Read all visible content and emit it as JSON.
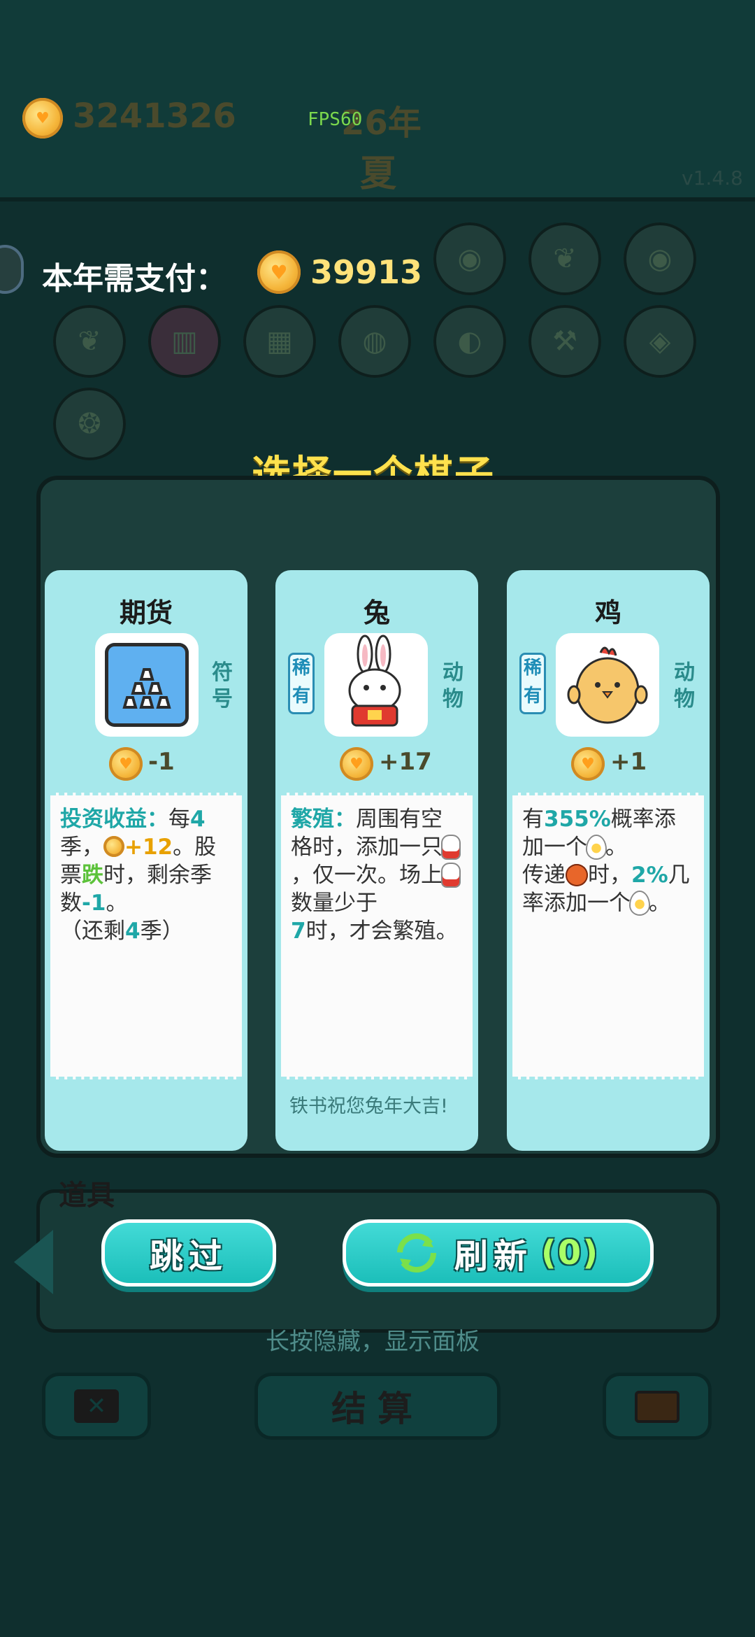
{
  "hud": {
    "money": "3241326",
    "year": "26年",
    "season": "夏",
    "fps": "FPS60",
    "version": "v1.4.8"
  },
  "payment": {
    "label": "本年需支付：",
    "amount": "39913"
  },
  "choose_title": "选择一个棋子",
  "cards": [
    {
      "name": "期货",
      "type_tag": "符号",
      "rarity": "",
      "price": "-1",
      "desc": {
        "keyword": "投资收益：",
        "t1": "每",
        "n1": "4",
        "t2": "季，",
        "gain": "+12",
        "t3": "。股票",
        "fall": "跌",
        "t4": "时，剩余季数",
        "minus": "-1",
        "t5": "。",
        "t6": "（还剩",
        "n2": "4",
        "t7": "季）"
      },
      "footer": ""
    },
    {
      "name": "兔",
      "type_tag": "动物",
      "rarity": "稀有",
      "price": "+17",
      "desc": {
        "keyword": "繁殖：",
        "t1": "周围有空格时，添加一只",
        "t2": "，仅一次。场上",
        "t3": "数量少于",
        "n1": "7",
        "t4": "时，才会繁殖。"
      },
      "footer": "铁书祝您兔年大吉!"
    },
    {
      "name": "鸡",
      "type_tag": "动物",
      "rarity": "稀有",
      "price": "+1",
      "desc": {
        "t1": "有",
        "p1": "355%",
        "t2": "概率添加一个",
        "t3": "。",
        "t4": "传递",
        "t5": "时，",
        "p2": "2%",
        "t6": "几率添加一个",
        "t7": "。"
      },
      "footer": ""
    }
  ],
  "buttons": {
    "skip": "跳过",
    "refresh": "刷新",
    "refresh_count": "(0)"
  },
  "hint": "长按隐藏，显示面板",
  "tools_label": "道具",
  "settle": "结算",
  "icons": [
    "coin-icon",
    "leaf-icon",
    "fries-icon",
    "egg-carton-icon",
    "piggy-bank-icon",
    "pear-icon",
    "hammer-icon",
    "compass-icon",
    "basketball-icon",
    "gold-bars-icon",
    "rabbit-icon",
    "chick-icon",
    "refresh-icon",
    "delete-icon",
    "briefcase-icon",
    "arrow-left-icon"
  ]
}
